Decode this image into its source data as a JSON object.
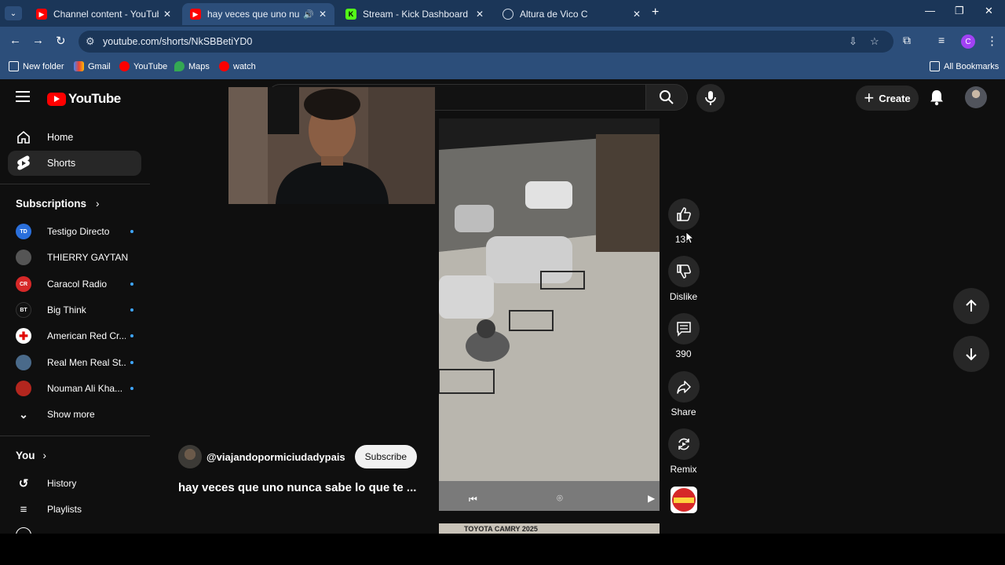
{
  "browser": {
    "tabs": [
      {
        "title": "Channel content - YouTube Stu",
        "icon": "youtube-studio-icon",
        "color": "#ff0000"
      },
      {
        "title": "hay veces que uno nunca s",
        "icon": "youtube-icon",
        "color": "#ff0000",
        "active": true
      },
      {
        "title": "Stream - Kick Dashboard",
        "icon": "kick-icon",
        "color": "#53fc18"
      },
      {
        "title": "Altura de Vico C",
        "icon": "globe-icon",
        "color": "#cfd9e6"
      }
    ],
    "url": "youtube.com/shorts/NkSBBetiYD0",
    "profile_initial": "C",
    "bookmarks": [
      {
        "label": "New folder",
        "icon": "folder-icon"
      },
      {
        "label": "Gmail",
        "icon": "gmail-icon"
      },
      {
        "label": "YouTube",
        "icon": "youtube-icon"
      },
      {
        "label": "Maps",
        "icon": "maps-icon"
      },
      {
        "label": "watch",
        "icon": "youtube-icon"
      }
    ],
    "all_bookmarks": "All Bookmarks"
  },
  "youtube": {
    "logo": "YouTube",
    "create": "Create",
    "nav": {
      "home": "Home",
      "shorts": "Shorts"
    },
    "subscriptions_title": "Subscriptions",
    "subscriptions": [
      {
        "name": "Testigo Directo",
        "color": "#2a6fdb",
        "dot": true
      },
      {
        "name": "THIERRY GAYTAN",
        "color": "#555555",
        "dot": false
      },
      {
        "name": "Caracol Radio",
        "color": "#d62828",
        "dot": true
      },
      {
        "name": "Big Think",
        "color": "#111111",
        "dot": true
      },
      {
        "name": "American Red Cr...",
        "color": "#ffffff",
        "dot": true
      },
      {
        "name": "Real Men Real St...",
        "color": "#4a6a8a",
        "dot": true
      },
      {
        "name": "Nouman Ali Kha...",
        "color": "#b3261e",
        "dot": true
      }
    ],
    "show_more": "Show more",
    "you_title": "You",
    "you_items": {
      "history": "History",
      "playlists": "Playlists"
    },
    "short": {
      "channel": "@viajandopormiciudadypais",
      "subscribe": "Subscribe",
      "title": "hay veces que uno nunca sabe lo que te ...",
      "likes": "13K",
      "dislike": "Dislike",
      "comments": "390",
      "share": "Share",
      "remix": "Remix",
      "next_title": "TOYOTA CAMRY 2025"
    }
  }
}
